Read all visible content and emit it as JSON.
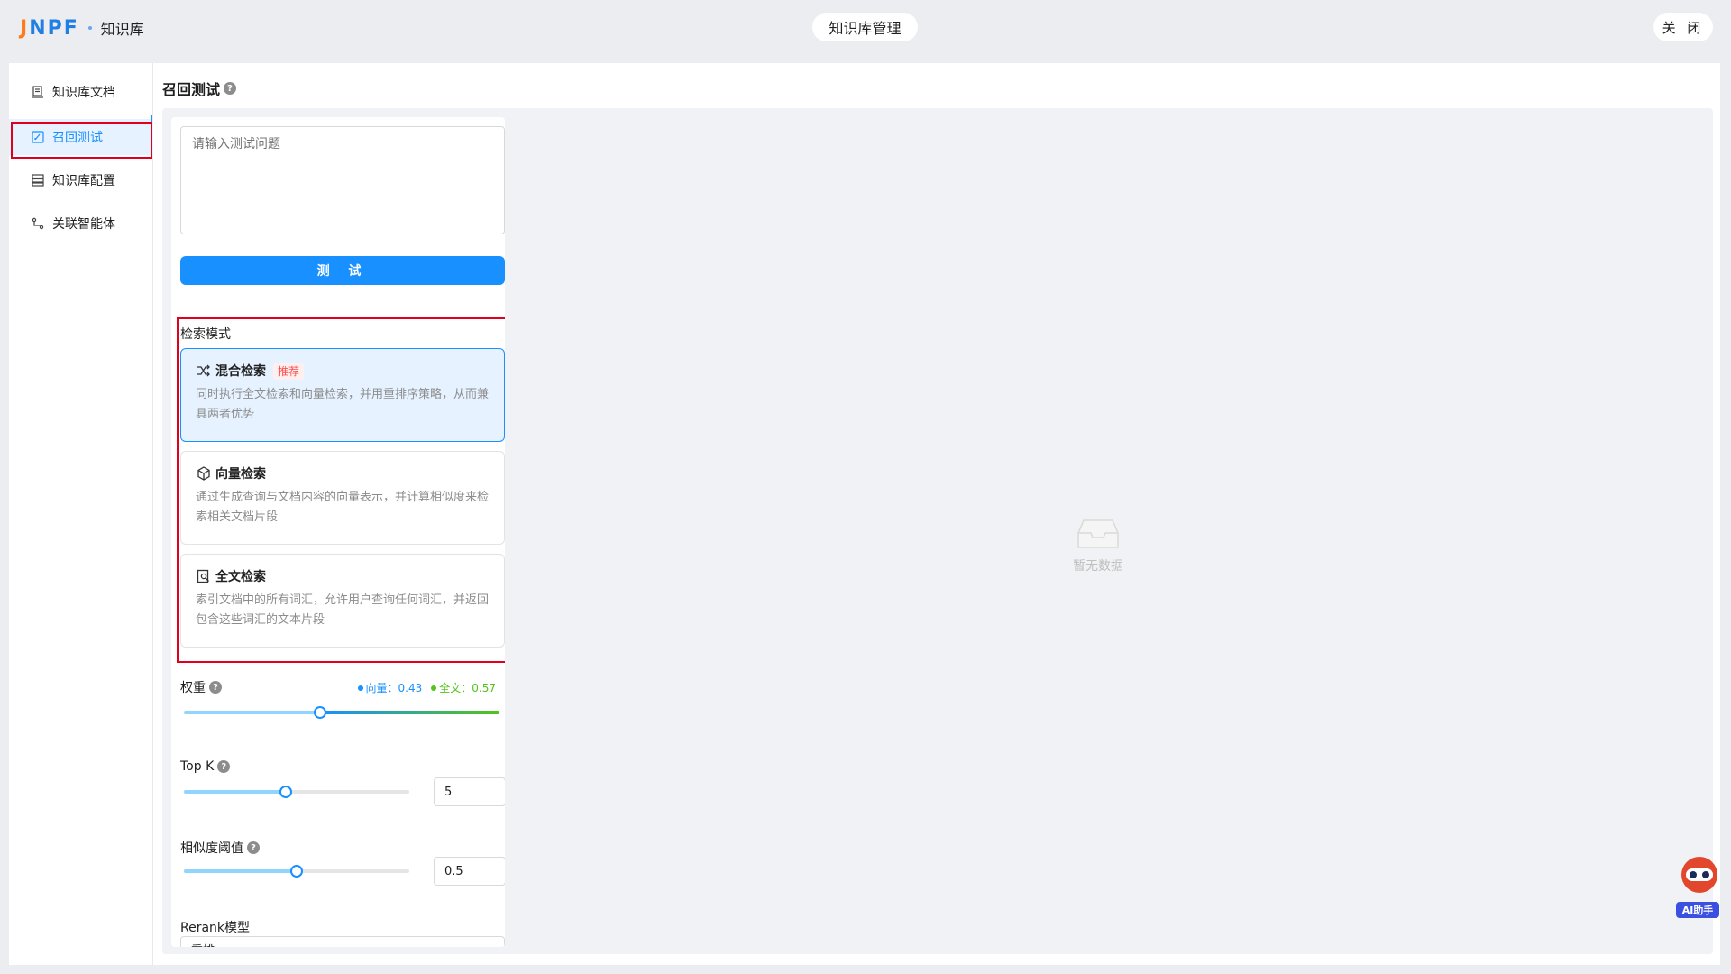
{
  "header": {
    "logo": "JNPF",
    "section": "知识库",
    "center_title": "知识库管理",
    "close_label": "关 闭"
  },
  "sidebar": {
    "items": [
      {
        "label": "知识库文档",
        "icon": "document-icon",
        "active": false
      },
      {
        "label": "召回测试",
        "icon": "edit-icon",
        "active": true
      },
      {
        "label": "知识库配置",
        "icon": "database-icon",
        "active": false
      },
      {
        "label": "关联智能体",
        "icon": "link-flow-icon",
        "active": false
      }
    ]
  },
  "page": {
    "title": "召回测试",
    "question_placeholder": "请输入测试问题",
    "test_button": "测 试",
    "mode_label": "检索模式",
    "modes": [
      {
        "title": "混合检索",
        "badge": "推荐",
        "desc": "同时执行全文检索和向量检索，并用重排序策略，从而兼具两者优势",
        "icon": "shuffle-icon",
        "active": true
      },
      {
        "title": "向量检索",
        "badge": "",
        "desc": "通过生成查询与文档内容的向量表示，并计算相似度来检索相关文档片段",
        "icon": "cube-icon",
        "active": false
      },
      {
        "title": "全文检索",
        "badge": "",
        "desc": "索引文档中的所有词汇，允许用户查询任何词汇，并返回包含这些词汇的文本片段",
        "icon": "doc-search-icon",
        "active": false
      }
    ],
    "weight": {
      "label": "权重",
      "vector_text": "向量：0.43",
      "fulltext_text": "全文：0.57",
      "vector_value": 0.43,
      "vector_color": "#1890ff",
      "fulltext_color": "#52c41a"
    },
    "topk": {
      "label": "Top K",
      "value": "5",
      "slider_fraction": 0.45
    },
    "threshold": {
      "label": "相似度阈值",
      "value": "0.5",
      "slider_fraction": 0.5
    },
    "rerank": {
      "label": "Rerank模型",
      "value": "重排"
    },
    "empty_text": "暂无数据"
  },
  "ai_helper": {
    "label": "AI助手"
  },
  "colors": {
    "accent": "#1890ff",
    "highlight_border": "#e0001b"
  }
}
